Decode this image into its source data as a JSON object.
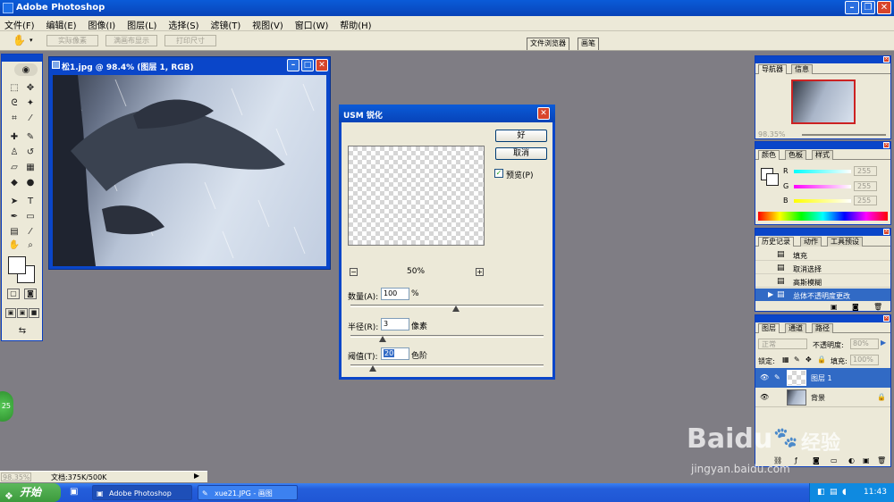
{
  "app": {
    "title": "Adobe Photoshop"
  },
  "menu": [
    "文件(F)",
    "编辑(E)",
    "图像(I)",
    "图层(L)",
    "选择(S)",
    "滤镜(T)",
    "视图(V)",
    "窗口(W)",
    "帮助(H)"
  ],
  "options": {
    "actual_pixels": "实际像素",
    "fit_on_screen": "满画布显示",
    "print_size": "打印尺寸",
    "file_browser": "文件浏览器",
    "brushes": "画笔"
  },
  "document": {
    "title": "松1.jpg @ 98.4% (图层 1, RGB)"
  },
  "dialog": {
    "title": "USM 锐化",
    "ok": "好",
    "cancel": "取消",
    "preview_label": "预览(P)",
    "preview_checked": true,
    "zoom": "50%",
    "amount_label": "数量(A):",
    "amount": "100",
    "amount_unit": "%",
    "radius_label": "半径(R):",
    "radius": "3",
    "radius_unit": "像素",
    "threshold_label": "阈值(T):",
    "threshold": "20",
    "threshold_unit": "色阶"
  },
  "navigator": {
    "tabs": [
      "导航器",
      "信息"
    ],
    "zoom": "98.35%"
  },
  "color": {
    "tabs": [
      "颜色",
      "色板",
      "样式"
    ],
    "r_label": "R",
    "g_label": "G",
    "b_label": "B",
    "r": "255",
    "g": "255",
    "b": "255"
  },
  "history": {
    "tabs": [
      "历史记录",
      "动作",
      "工具预设"
    ],
    "items": [
      "填充",
      "取消选择",
      "高斯模糊",
      "总体不透明度更改"
    ]
  },
  "layers": {
    "tabs": [
      "图层",
      "通道",
      "路径"
    ],
    "blend_mode": "正常",
    "opacity_label": "不透明度:",
    "opacity": "80%",
    "lock_label": "锁定:",
    "fill_label": "填充:",
    "fill": "100%",
    "items": [
      "图层 1",
      "背景"
    ]
  },
  "status": {
    "zoom": "98.35%",
    "doc": "文档:375K/500K"
  },
  "taskbar": {
    "start": "开始",
    "tasks": [
      "Adobe Photoshop",
      "xue21.JPG - 画图"
    ],
    "clock": "11:43"
  },
  "watermark": {
    "brand": "Baidu",
    "sub": "经验",
    "url": "jingyan.baidu.com"
  },
  "badge": "25",
  "colors": {
    "titlebar": "#0a46c9",
    "chrome": "#ece9d8",
    "workspace": "#7f7d84",
    "selection": "#316ac5"
  }
}
